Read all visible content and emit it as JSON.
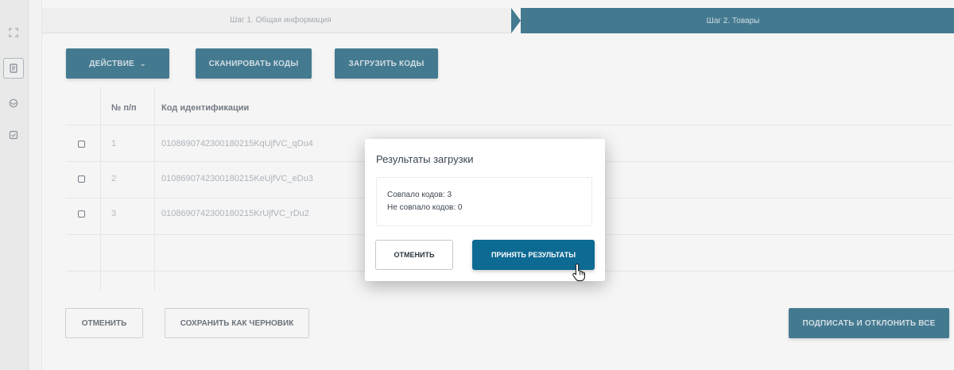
{
  "rail": {
    "icons": [
      "expand-icon",
      "document-icon",
      "box-icon",
      "checked-doc-icon"
    ]
  },
  "stepper": {
    "step1": "Шаг 1. Общая информация",
    "step2": "Шаг 2. Товары",
    "active_color": "#0d5472"
  },
  "toolbar": {
    "action_label": "ДЕЙСТВИЕ",
    "scan_label": "СКАНИРОВАТЬ КОДЫ",
    "upload_label": "ЗАГРУЗИТЬ КОДЫ"
  },
  "table": {
    "columns": [
      "№ п/п",
      "Код идентификации"
    ],
    "rows": [
      {
        "n": "1",
        "code": "0108690742300180215KqUjfVC_qDu4"
      },
      {
        "n": "2",
        "code": "0108690742300180215KeUjfVC_eDu3"
      },
      {
        "n": "3",
        "code": "0108690742300180215KrUjfVC_rDu2"
      }
    ]
  },
  "footer": {
    "cancel_label": "ОТМЕНИТЬ",
    "draft_label": "СОХРАНИТЬ КАК ЧЕРНОВИК",
    "sign_label": "ПОДПИСАТЬ И ОТКЛОНИТЬ ВСЕ"
  },
  "modal": {
    "title": "Результаты загрузки",
    "matched": "Совпало кодов: 3",
    "unmatched": "Не совпало кодов: 0",
    "cancel_label": "ОТМЕНИТЬ",
    "accept_label": "ПРИНЯТЬ РЕЗУЛЬТАТЫ",
    "accent": "#0d6a93"
  }
}
